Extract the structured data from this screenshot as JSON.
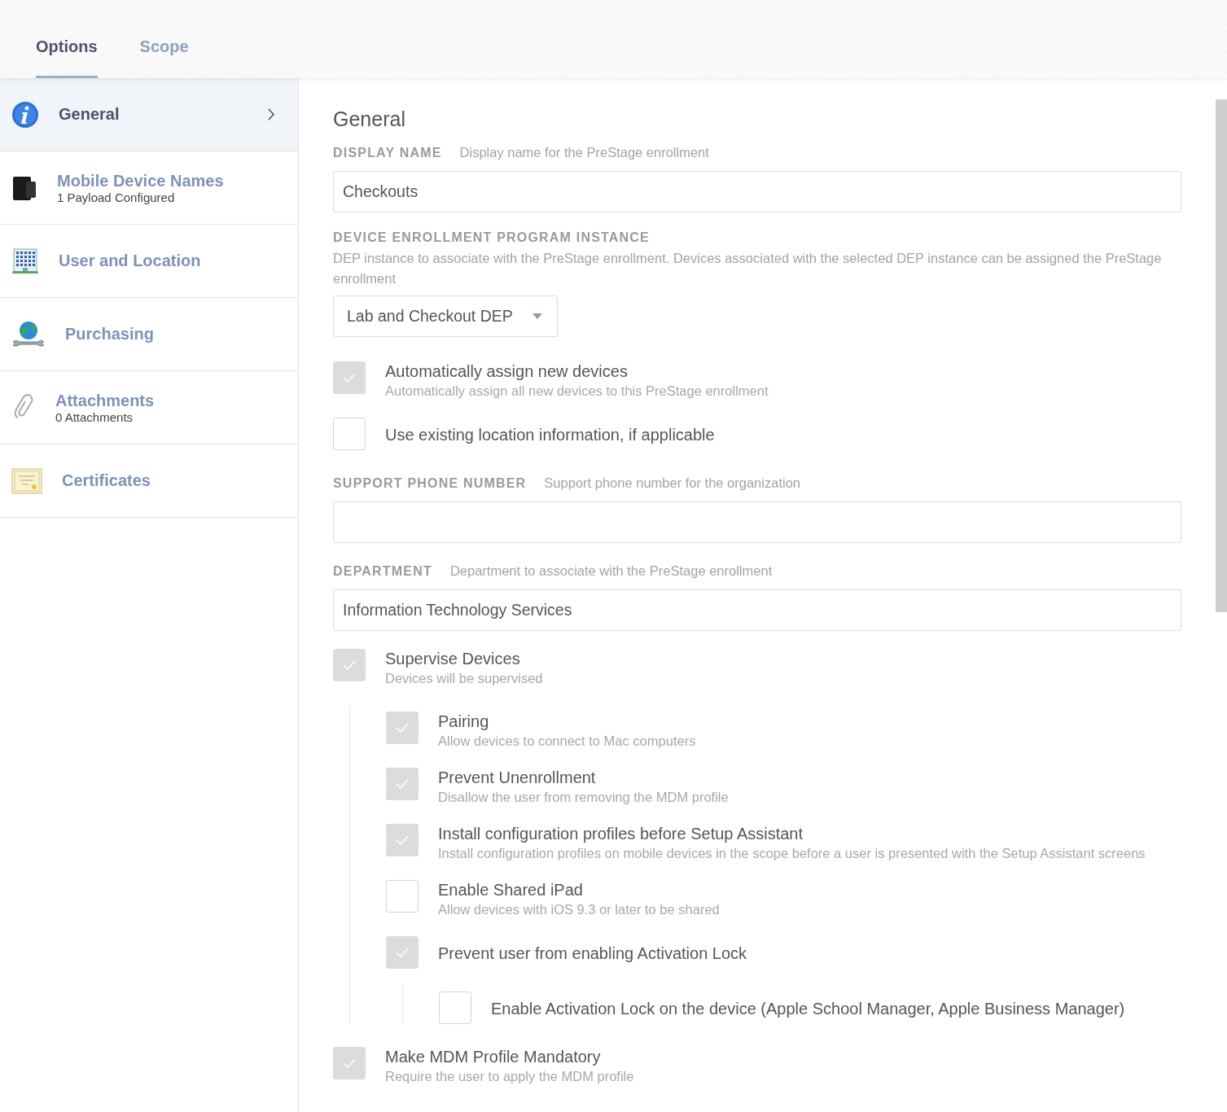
{
  "tabs": [
    {
      "label": "Options",
      "selected": true
    },
    {
      "label": "Scope",
      "selected": false
    }
  ],
  "sidebar": {
    "items": [
      {
        "label": "General",
        "selected": true
      },
      {
        "label": "Mobile Device Names",
        "sublabel": "1 Payload Configured",
        "selected": false
      },
      {
        "label": "User and Location",
        "selected": false
      },
      {
        "label": "Purchasing",
        "selected": false
      },
      {
        "label": "Attachments",
        "sublabel": "0 Attachments",
        "selected": false
      },
      {
        "label": "Certificates",
        "selected": false
      }
    ]
  },
  "content": {
    "title": "General",
    "items": [
      {
        "kind": "text",
        "label": "DISPLAY NAME",
        "description": "Display name for the PreStage enrollment",
        "value": "Checkouts"
      },
      {
        "kind": "select",
        "label": "DEVICE ENROLLMENT PROGRAM INSTANCE",
        "description": "DEP instance to associate with the PreStage enrollment. Devices associated with the selected DEP instance can be assigned the PreStage enrollment",
        "value": "Lab and Checkout DEP"
      },
      {
        "kind": "checkbox",
        "label": "Automatically assign new devices",
        "description": "Automatically assign all new devices to this PreStage enrollment",
        "checked": true
      },
      {
        "kind": "checkbox",
        "label": "Use existing location information, if applicable",
        "checked": false
      },
      {
        "kind": "text",
        "label": "SUPPORT PHONE NUMBER",
        "description": "Support phone number for the organization"
      },
      {
        "kind": "text",
        "label": "DEPARTMENT",
        "description": "Department to associate with the PreStage enrollment",
        "value": "Information Technology Services"
      },
      {
        "kind": "checkbox",
        "label": "Supervise Devices",
        "description": "Devices will be supervised",
        "checked": true,
        "children": [
          {
            "kind": "checkbox",
            "label": "Pairing",
            "description": "Allow devices to connect to Mac computers",
            "checked": true
          },
          {
            "kind": "checkbox",
            "label": "Prevent Unenrollment",
            "description": "Disallow the user from removing the MDM profile",
            "checked": true
          },
          {
            "kind": "checkbox",
            "label": "Install configuration profiles before Setup Assistant",
            "description": "Install configuration profiles on mobile devices in the scope before a user is presented with the Setup Assistant screens",
            "checked": true
          },
          {
            "kind": "checkbox",
            "label": "Enable Shared iPad",
            "description": "Allow devices with iOS 9.3 or later to be shared",
            "checked": false
          },
          {
            "kind": "checkbox",
            "label": "Prevent user from enabling Activation Lock",
            "checked": true,
            "children": [
              {
                "kind": "checkbox",
                "label": "Enable Activation Lock on the device (Apple School Manager, Apple Business Manager)",
                "checked": false
              }
            ]
          }
        ]
      },
      {
        "kind": "checkbox",
        "label": "Make MDM Profile Mandatory",
        "description": "Require the user to apply the MDM profile",
        "checked": true
      }
    ]
  }
}
